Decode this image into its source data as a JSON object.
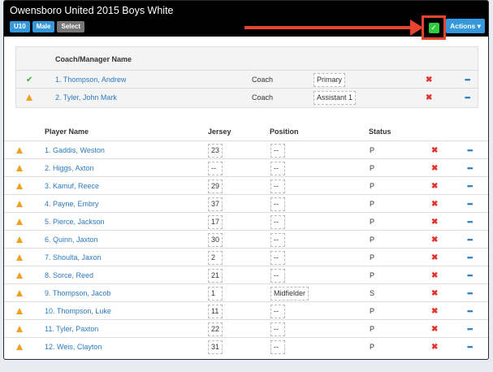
{
  "header": {
    "title": "Owensboro United 2015 Boys White",
    "badges": [
      "U10",
      "Male",
      "Select"
    ],
    "actions_label": "Actions",
    "actions_caret": "▾",
    "check_glyph": "✓"
  },
  "coaches": {
    "header": "Coach/Manager Name",
    "rows": [
      {
        "name": "1. Thompson, Andrew",
        "role": "Coach",
        "type": "Primary",
        "status_icon": "check"
      },
      {
        "name": "2. Tyler, John Mark",
        "role": "Coach",
        "type": "Assistant 1",
        "status_icon": "warning"
      }
    ]
  },
  "players": {
    "headers": {
      "name": "Player Name",
      "jersey": "Jersey",
      "position": "Position",
      "status": "Status"
    },
    "rows": [
      {
        "name": "1. Gaddis, Weston",
        "jersey": "23",
        "position": "--",
        "status": "P"
      },
      {
        "name": "2. Higgs, Axton",
        "jersey": "--",
        "position": "--",
        "status": "P"
      },
      {
        "name": "3. Kamuf, Reece",
        "jersey": "29",
        "position": "--",
        "status": "P"
      },
      {
        "name": "4. Payne, Embry",
        "jersey": "37",
        "position": "--",
        "status": "P"
      },
      {
        "name": "5. Pierce, Jackson",
        "jersey": "17",
        "position": "--",
        "status": "P"
      },
      {
        "name": "6. Quinn, Jaxton",
        "jersey": "30",
        "position": "--",
        "status": "P"
      },
      {
        "name": "7. Shoulta, Jaxon",
        "jersey": "2",
        "position": "--",
        "status": "P"
      },
      {
        "name": "8. Sorce, Reed",
        "jersey": "21",
        "position": "--",
        "status": "P"
      },
      {
        "name": "9. Thompson, Jacob",
        "jersey": "1",
        "position": "Midfielder",
        "status": "S"
      },
      {
        "name": "10. Thompson, Luke",
        "jersey": "11",
        "position": "--",
        "status": "P"
      },
      {
        "name": "11. Tyler, Paxton",
        "jersey": "22",
        "position": "--",
        "status": "P"
      },
      {
        "name": "12. Weis, Clayton",
        "jersey": "31",
        "position": "--",
        "status": "P"
      }
    ]
  },
  "icons": {
    "remove": "✖",
    "more": "•••"
  },
  "colors": {
    "accent": "#3498db",
    "warning": "#f0a020",
    "remove": "#e2322b",
    "ok": "#3aae3a",
    "highlight": "#e8432c"
  }
}
